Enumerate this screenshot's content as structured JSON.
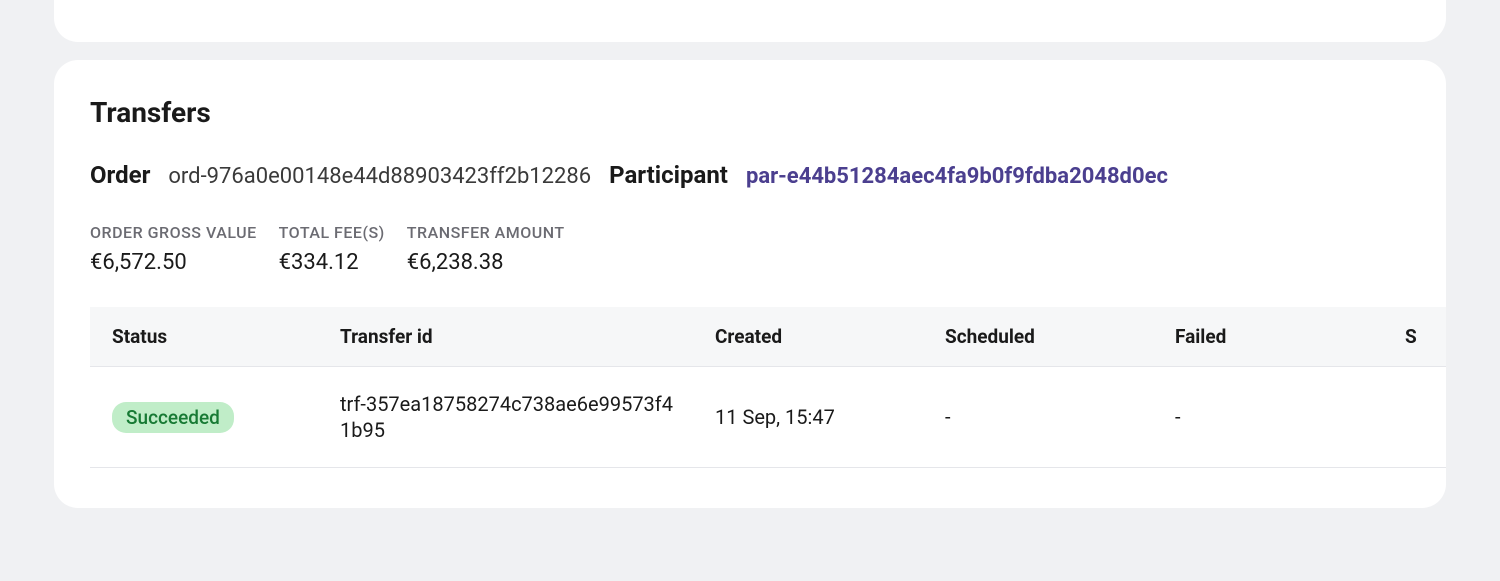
{
  "section": {
    "title": "Transfers"
  },
  "order": {
    "label": "Order",
    "value": "ord-976a0e00148e44d88903423ff2b12286"
  },
  "participant": {
    "label": "Participant",
    "value": "par-e44b51284aec4fa9b0f9fdba2048d0ec"
  },
  "stats": {
    "gross": {
      "label": "ORDER GROSS VALUE",
      "value": "€6,572.50"
    },
    "fees": {
      "label": "TOTAL FEE(S)",
      "value": "€334.12"
    },
    "transfer": {
      "label": "TRANSFER AMOUNT",
      "value": "€6,238.38"
    }
  },
  "table": {
    "headers": {
      "status": "Status",
      "transfer_id": "Transfer id",
      "created": "Created",
      "scheduled": "Scheduled",
      "failed": "Failed",
      "extra": "S"
    },
    "rows": [
      {
        "status": "Succeeded",
        "transfer_id": "trf-357ea18758274c738ae6e99573f41b95",
        "created": "11 Sep, 15:47",
        "scheduled": "-",
        "failed": "-"
      }
    ]
  }
}
